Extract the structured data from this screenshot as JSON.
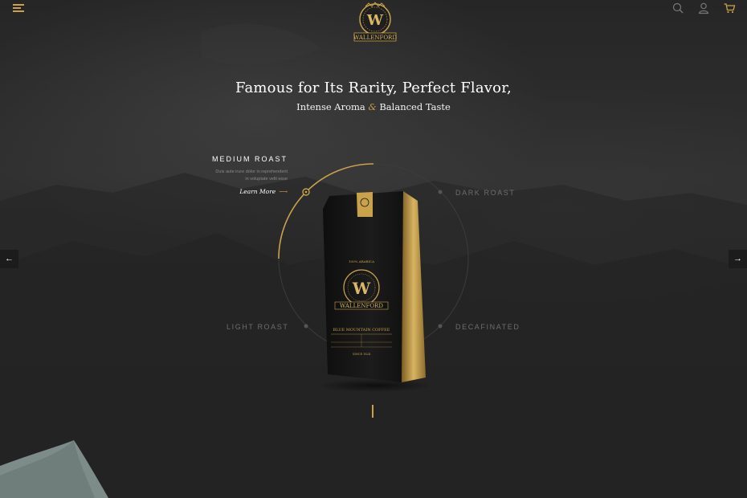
{
  "header": {
    "menu_icon": "hamburger-menu-icon",
    "logo_text": "WALLENFORD",
    "logo_letter": "W",
    "icons": [
      "search-icon",
      "user-icon",
      "cart-icon"
    ]
  },
  "hero": {
    "title": "Famous for Its Rarity, Perfect Flavor,",
    "subtitle_part1": "Intense Aroma",
    "subtitle_amp": "&",
    "subtitle_part2": "Balanced Taste"
  },
  "roast_selector": {
    "active": {
      "title": "MEDIUM ROAST",
      "description_line1": "Duis aute irure dolor in reprehenderit",
      "description_line2": "in voluptate velit esse",
      "link_label": "Learn More",
      "link_arrow": "⟶"
    },
    "options": [
      {
        "label": "DARK ROAST"
      },
      {
        "label": "LIGHT ROAST"
      },
      {
        "label": "DECAFINATED"
      }
    ]
  },
  "product": {
    "brand": "WALLENFORD",
    "name": "BLUE MOUNTAIN COFFEE",
    "est": "SINCE 1824",
    "top_text": "100% ARABICA"
  },
  "navigation": {
    "prev_label": "←",
    "next_label": "→"
  },
  "colors": {
    "accent": "#c9a24a",
    "background": "#2a2a2a",
    "muted_text": "#6c6c6c"
  }
}
